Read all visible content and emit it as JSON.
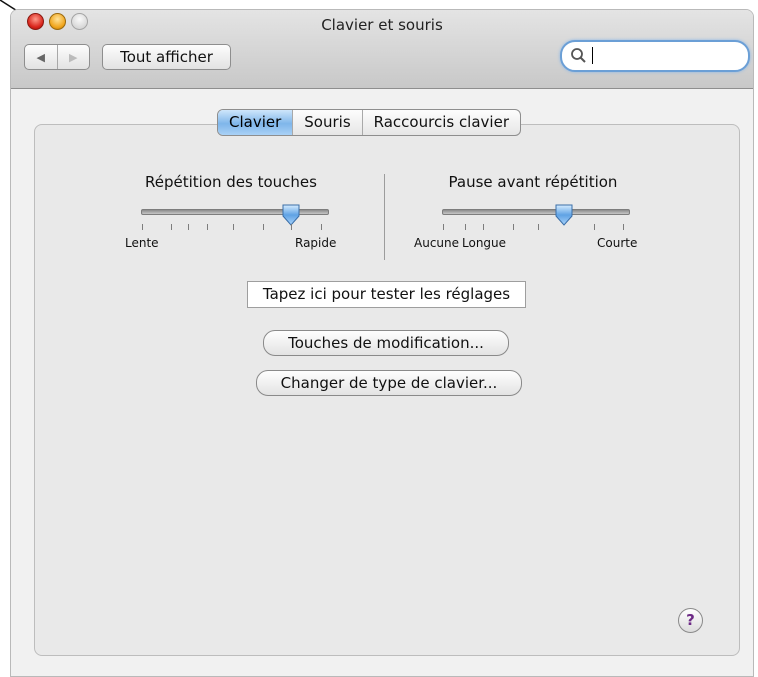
{
  "window": {
    "title": "Clavier et souris"
  },
  "toolbar": {
    "back_icon": "◀",
    "forward_icon": "▶",
    "show_all_label": "Tout afficher",
    "search_value": ""
  },
  "tabs": [
    {
      "label": "Clavier",
      "active": true
    },
    {
      "label": "Souris",
      "active": false
    },
    {
      "label": "Raccourcis clavier",
      "active": false
    }
  ],
  "key_repeat": {
    "title": "Répétition des touches",
    "min_label": "Lente",
    "max_label": "Rapide",
    "value_fraction": 0.8
  },
  "repeat_delay": {
    "title": "Pause avant répétition",
    "min_label": "Aucune",
    "mid_label": "Longue",
    "max_label": "Courte",
    "value_fraction": 0.66
  },
  "test_field_value": "Tapez ici pour tester les réglages",
  "buttons": {
    "modifier_keys": "Touches de modification...",
    "change_keyboard": "Changer de type de clavier..."
  },
  "help_label": "?",
  "colors": {
    "accent_blue": "#7fb6ea",
    "close_red": "#d8231a",
    "minimize_yellow": "#f0a51c"
  }
}
